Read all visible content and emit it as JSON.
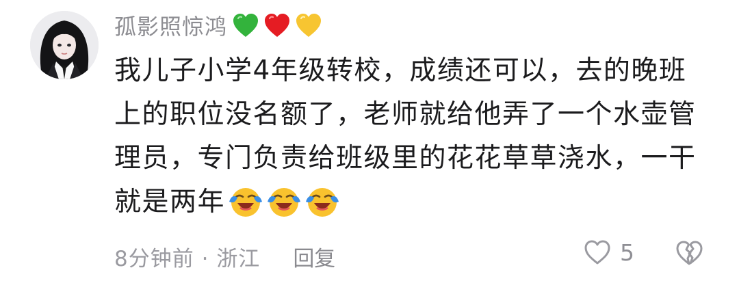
{
  "comment": {
    "username": "孤影照惊鸿",
    "username_badges": [
      "green-heart",
      "red-heart",
      "yellow-heart"
    ],
    "text_lines": [
      "我儿子小学4年级转校，成绩还可以，去的晚班",
      "上的职位没名额了，老师就给他弄了一个水壶管",
      "理员，专门负责给班级里的花花草草浇水，一干",
      "就是两年"
    ],
    "trailing_emojis": [
      "crying-laughing",
      "crying-laughing",
      "crying-laughing"
    ],
    "time": "8分钟前",
    "separator": "·",
    "location": "浙江",
    "reply_label": "回复",
    "like_count": "5"
  },
  "colors": {
    "username": "#8d8d92",
    "body_text": "#1b1b1d",
    "meta_text": "#9a9aa0",
    "heart_green": "#33b33c",
    "heart_red": "#e51c23",
    "heart_yellow": "#f7c531"
  }
}
